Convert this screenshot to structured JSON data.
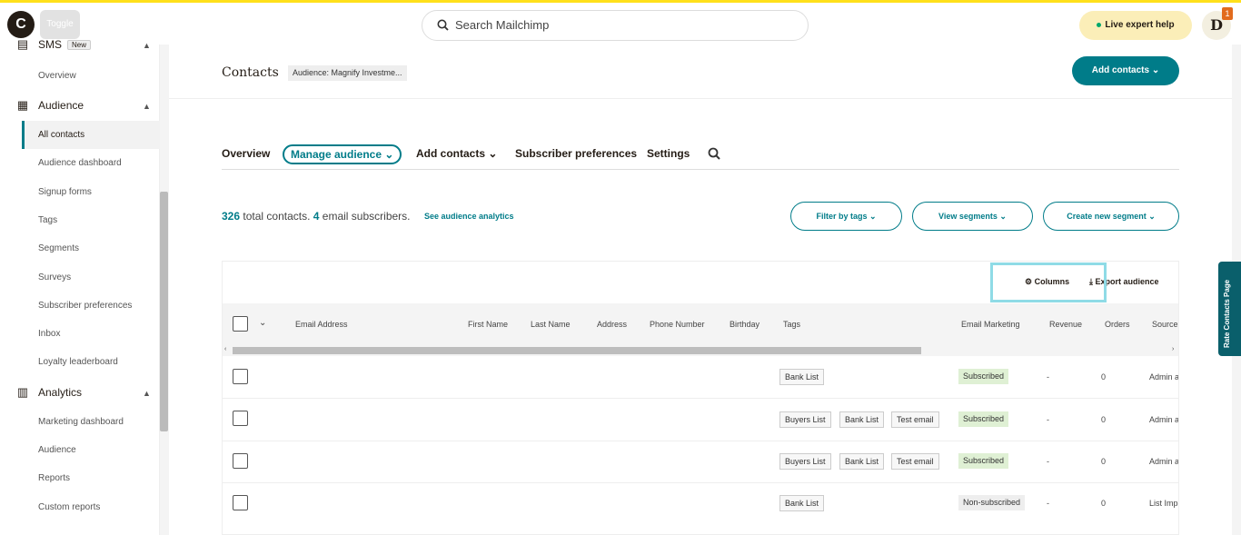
{
  "topbar": {
    "logo_letter": "C",
    "toggle_label": "Toggle",
    "search_placeholder": "Search Mailchimp",
    "expert_help": "Live expert help",
    "avatar_letter": "D",
    "avatar_badge": "1"
  },
  "sidebar": {
    "sms": {
      "label": "SMS",
      "badge": "New",
      "items": [
        "Overview"
      ]
    },
    "audience": {
      "label": "Audience",
      "items": [
        "All contacts",
        "Audience dashboard",
        "Signup forms",
        "Tags",
        "Segments",
        "Surveys",
        "Subscriber preferences",
        "Inbox",
        "Loyalty leaderboard"
      ]
    },
    "analytics": {
      "label": "Analytics",
      "items": [
        "Marketing dashboard",
        "Audience",
        "Reports",
        "Custom reports"
      ]
    }
  },
  "header": {
    "title": "Contacts",
    "audience_chip": "Audience: Magnify Investme...",
    "add_contacts": "Add contacts"
  },
  "tabs": [
    "Overview",
    "Manage audience",
    "Add contacts",
    "Subscriber preferences",
    "Settings"
  ],
  "summary": {
    "total": "326",
    "total_text": "total contacts.",
    "email": "4",
    "email_text": "email subscribers.",
    "analytics_link": "See audience analytics"
  },
  "actions": {
    "filter_tags": "Filter by tags",
    "view_segments": "View segments",
    "create_segment": "Create new segment",
    "columns": "Columns",
    "export": "Export audience"
  },
  "table": {
    "headers": [
      "Email Address",
      "First Name",
      "Last Name",
      "Address",
      "Phone Number",
      "Birthday",
      "Tags",
      "Email Marketing",
      "Revenue",
      "Orders",
      "Source"
    ],
    "rows": [
      {
        "tags": [
          "Bank List"
        ],
        "status": "Subscribed",
        "revenue": "-",
        "orders": "0",
        "source": "Admin a"
      },
      {
        "tags": [
          "Buyers List",
          "Bank List",
          "Test email"
        ],
        "status": "Subscribed",
        "revenue": "-",
        "orders": "0",
        "source": "Admin a"
      },
      {
        "tags": [
          "Buyers List",
          "Bank List",
          "Test email"
        ],
        "status": "Subscribed",
        "revenue": "-",
        "orders": "0",
        "source": "Admin a"
      },
      {
        "tags": [
          "Bank List"
        ],
        "status": "Non-subscribed",
        "revenue": "-",
        "orders": "0",
        "source": "List Imp"
      }
    ]
  },
  "feedback_tab": "Rate Contacts Page",
  "colors": {
    "accent": "#007c89",
    "brand_yellow": "#ffe01b",
    "subscribed_bg": "#dff0d4"
  }
}
